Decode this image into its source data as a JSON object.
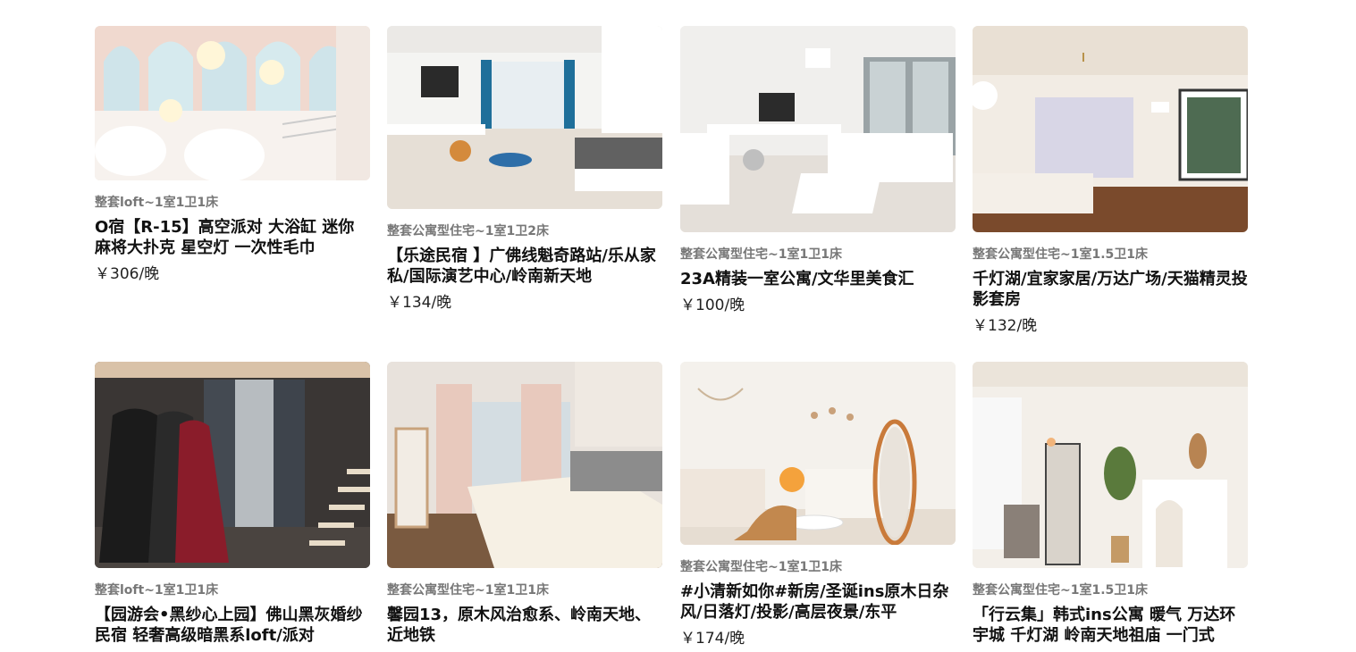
{
  "listings": [
    {
      "type": "整套loft~1室1卫1床",
      "title": "O宿【R-15】高空派对 大浴缸 迷你麻将大扑克 星空灯 一次性毛巾",
      "price": "￥306/晚",
      "photo": "pink-arched-loft-with-cloud-lamps"
    },
    {
      "type": "整套公寓型住宅~1室1卫2床",
      "title": "【乐途民宿 】广佛线魁奇路站/乐从家私/国际演艺中心/岭南新天地",
      "price": "￥134/晚",
      "photo": "bright-room-with-blue-curtains"
    },
    {
      "type": "整套公寓型住宅~1室1卫1床",
      "title": "23A精装一室公寓/文华里美食汇",
      "price": "￥100/晚",
      "photo": "white-studio-with-desk"
    },
    {
      "type": "整套公寓型住宅~1室1.5卫1床",
      "title": "千灯湖/宜家家居/万达广场/天猫精灵投影套房",
      "price": "￥132/晚",
      "photo": "room-with-projector-screen"
    },
    {
      "type": "整套loft~1室1卫1床",
      "title": "【园游会•黑纱心上园】佛山黑灰婚纱民宿 轻奢高级暗黑系loft/派对",
      "price": "",
      "photo": "dark-loft-with-dresses-and-stairs"
    },
    {
      "type": "整套公寓型住宅~1室1卫1床",
      "title": "馨园13，原木风治愈系、岭南天地、近地铁",
      "price": "",
      "photo": "wooden-room-with-floral-bedding"
    },
    {
      "type": "整套公寓型住宅~1室1卫1床",
      "title": "#小清新如你#新房/圣诞ins原木日杂风/日落灯/投影/高层夜景/东平",
      "price": "￥174/晚",
      "photo": "cream-room-with-mirror"
    },
    {
      "type": "整套公寓型住宅~1室1.5卫1床",
      "title": "「行云集」韩式ins公寓 暖气 万达环宇城 千灯湖 岭南天地祖庙 一门式",
      "price": "",
      "photo": "ins-style-room-with-plant"
    }
  ]
}
